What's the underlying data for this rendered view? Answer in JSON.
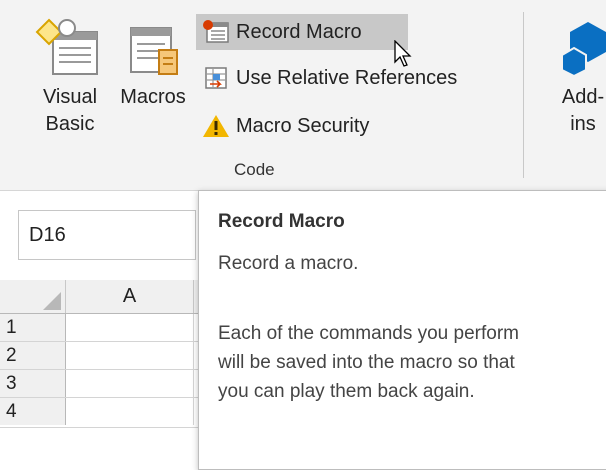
{
  "ribbon": {
    "visual_basic_label_1": "Visual",
    "visual_basic_label_2": "Basic",
    "macros_label": "Macros",
    "record_macro_label": "Record Macro",
    "relative_refs_label": "Use Relative References",
    "macro_security_label": "Macro Security",
    "group_label": "Code",
    "addins_label_1": "Add-",
    "addins_label_2": "ins"
  },
  "namebox": {
    "value": "D16"
  },
  "grid": {
    "column_header": "A",
    "rows": [
      "1",
      "2",
      "3",
      "4"
    ]
  },
  "tooltip": {
    "title": "Record Macro",
    "subtitle": "Record a macro.",
    "body": "Each of the commands you perform will be saved into the macro so that you can play them back again."
  },
  "icons": {
    "visual_basic": "visual-basic-icon",
    "macros": "macros-icon",
    "record_macro": "record-macro-icon",
    "relative_refs": "relative-references-icon",
    "macro_security": "warning-icon",
    "addins": "addins-icon"
  },
  "colors": {
    "ribbon_bg": "#f3f3f3",
    "hover_bg": "#c8c8c8",
    "warning": "#f2b600",
    "addins_blue": "#0a6fc2",
    "record_red": "#d83b01"
  }
}
